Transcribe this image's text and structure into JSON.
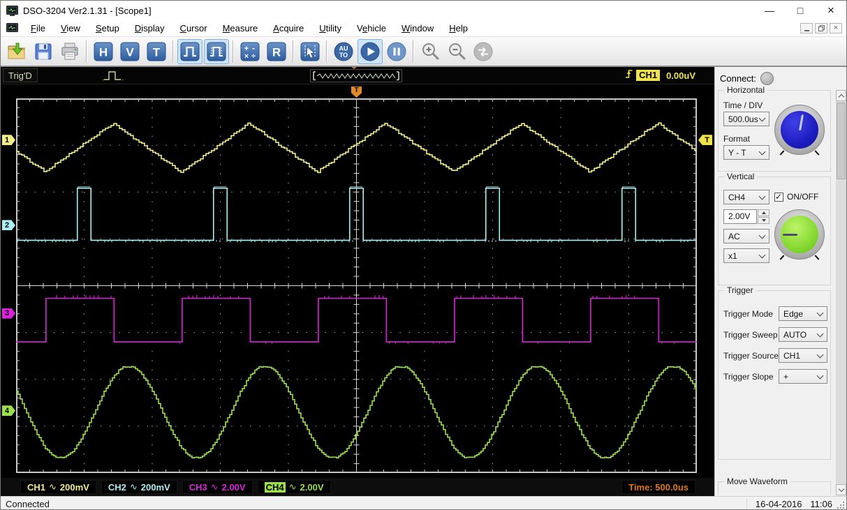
{
  "window": {
    "title": "DSO-3204 Ver2.1.31 - [Scope1]",
    "controls": {
      "minimize": "—",
      "maximize": "□",
      "close": "×"
    }
  },
  "menu": {
    "items": [
      {
        "pre": "",
        "u": "F",
        "post": "ile"
      },
      {
        "pre": "",
        "u": "V",
        "post": "iew"
      },
      {
        "pre": "",
        "u": "S",
        "post": "etup"
      },
      {
        "pre": "",
        "u": "D",
        "post": "isplay"
      },
      {
        "pre": "",
        "u": "C",
        "post": "ursor"
      },
      {
        "pre": "",
        "u": "M",
        "post": "easure"
      },
      {
        "pre": "",
        "u": "A",
        "post": "cquire"
      },
      {
        "pre": "",
        "u": "U",
        "post": "tility"
      },
      {
        "pre": "V",
        "u": "e",
        "post": "hicle"
      },
      {
        "pre": "",
        "u": "W",
        "post": "indow"
      },
      {
        "pre": "",
        "u": "H",
        "post": "elp"
      }
    ]
  },
  "toolbar": {
    "groups": [
      [
        {
          "name": "open-file-button",
          "icon": "folder-import",
          "active": false,
          "enabled": true
        },
        {
          "name": "save-button",
          "icon": "floppy",
          "active": false,
          "enabled": true
        },
        {
          "name": "print-button",
          "icon": "printer",
          "active": false,
          "enabled": true
        }
      ],
      [
        {
          "name": "horizontal-setup-button",
          "icon": "letter",
          "label": "H",
          "active": false,
          "enabled": true
        },
        {
          "name": "vertical-setup-button",
          "icon": "letter",
          "label": "V",
          "active": false,
          "enabled": true
        },
        {
          "name": "trigger-setup-button",
          "icon": "letter",
          "label": "T",
          "active": false,
          "enabled": true
        }
      ],
      [
        {
          "name": "pulse-waveform-button",
          "icon": "pulse",
          "active": true,
          "enabled": true
        },
        {
          "name": "pulse-train-button",
          "icon": "pulse-dotted",
          "active": true,
          "enabled": true
        }
      ],
      [
        {
          "name": "math-button",
          "icon": "math",
          "active": false,
          "enabled": true
        },
        {
          "name": "reference-wave-button",
          "icon": "letter",
          "label": "R",
          "active": false,
          "enabled": true
        }
      ],
      [
        {
          "name": "cursor-measure-button",
          "icon": "cursor",
          "active": false,
          "enabled": true
        }
      ],
      [
        {
          "name": "autoset-button",
          "icon": "auto",
          "label": "AUTO",
          "active": false,
          "enabled": true
        },
        {
          "name": "run-button",
          "icon": "play",
          "active": true,
          "enabled": true
        },
        {
          "name": "pause-button",
          "icon": "pause",
          "active": false,
          "enabled": true
        }
      ],
      [
        {
          "name": "zoom-in-button",
          "icon": "zoom-in",
          "active": false,
          "enabled": true
        },
        {
          "name": "zoom-out-button",
          "icon": "zoom-out",
          "active": false,
          "enabled": true
        },
        {
          "name": "sync-button",
          "icon": "sync",
          "active": false,
          "enabled": false
        }
      ]
    ]
  },
  "scope": {
    "trig_status": "Trig'D",
    "trigger_readout": {
      "channel": "CH1",
      "level": "0.00uV"
    },
    "time_readout": "Time: 500.0us",
    "channels": [
      {
        "id": "CH1",
        "coupling": "∿",
        "scale": "200mV",
        "color": "#f2ee8a",
        "selected": false
      },
      {
        "id": "CH2",
        "coupling": "∿",
        "scale": "200mV",
        "color": "#aaf0f2",
        "selected": false
      },
      {
        "id": "CH3",
        "coupling": "∿",
        "scale": "2.00V",
        "color": "#dd22dd",
        "selected": false
      },
      {
        "id": "CH4",
        "coupling": "∿",
        "scale": "2.00V",
        "color": "#9ce04a",
        "selected": true
      }
    ]
  },
  "panel": {
    "connect_label": "Connect:",
    "horizontal": {
      "title": "Horizontal",
      "time_div_label": "Time / DIV",
      "time_div_value": "500.0us",
      "format_label": "Format",
      "format_value": "Y - T"
    },
    "vertical": {
      "title": "Vertical",
      "channel_value": "CH4",
      "onoff_label": "ON/OFF",
      "onoff_checked": true,
      "scale_value": "2.00V",
      "coupling_value": "AC",
      "probe_value": "x1"
    },
    "trigger": {
      "title": "Trigger",
      "rows": [
        {
          "label": "Trigger Mode",
          "value": "Edge",
          "name": "trigger-mode"
        },
        {
          "label": "Trigger Sweep",
          "value": "AUTO",
          "name": "trigger-sweep"
        },
        {
          "label": "Trigger Source",
          "value": "CH1",
          "name": "trigger-source"
        },
        {
          "label": "Trigger Slope",
          "value": "+",
          "name": "trigger-slope"
        }
      ]
    },
    "move_waveform_title": "Move Waveform"
  },
  "statusbar": {
    "status": "Connected",
    "date": "16-04-2016",
    "time": "11:06"
  },
  "chart_data": {
    "type": "line",
    "description": "4-channel oscilloscope capture on a 10x8 division graticule",
    "grid": {
      "x_divisions": 10,
      "y_divisions": 8,
      "time_per_division": "500.0us"
    },
    "trigger": {
      "source": "CH1",
      "mode": "Edge",
      "sweep": "AUTO",
      "slope": "+",
      "level": "0.00uV",
      "position_div": 5.0,
      "level_marker_div": 0.89
    },
    "series": [
      {
        "name": "CH1",
        "shape": "triangle",
        "volts_per_div": "200mV",
        "color": "#f2ee8a",
        "period_divs": 2,
        "period_time": "1.0ms",
        "center_div": 1.05,
        "amplitude_divs": 0.52,
        "peak_at_div": 1.42,
        "marker_div": 0.89
      },
      {
        "name": "CH2",
        "shape": "pulse",
        "volts_per_div": "200mV",
        "color": "#aaf0f2",
        "period_divs": 2,
        "period_time": "1.0ms",
        "baseline_div": 3.03,
        "top_div": 1.92,
        "pulse_start_div": 0.9,
        "pulse_width_divs": 0.2,
        "marker_div": 2.71
      },
      {
        "name": "CH3",
        "shape": "square",
        "volts_per_div": "2.00V",
        "color": "#dd22dd",
        "period_divs": 2,
        "period_time": "1.0ms",
        "low_div": 5.2,
        "high_div": 4.27,
        "rise_at_div": 0.44,
        "duty_cycle": 0.5,
        "marker_div": 4.59
      },
      {
        "name": "CH4",
        "shape": "sine",
        "volts_per_div": "2.00V",
        "color": "#9ce04a",
        "period_divs": 2,
        "period_time": "1.0ms",
        "center_div": 6.7,
        "amplitude_divs": 0.98,
        "peak_at_div": 1.65,
        "marker_div": 6.67
      }
    ]
  }
}
